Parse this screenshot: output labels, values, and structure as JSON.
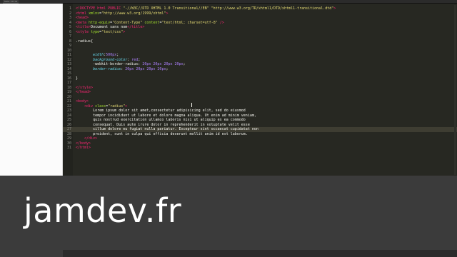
{
  "window": {
    "tab_label": "Sans titre"
  },
  "editor": {
    "lines": [
      {
        "n": "1",
        "parts": [
          [
            "tag",
            "<!DOCTYPE html PUBLIC "
          ],
          [
            "str",
            "\"-//W3C//DTD XHTML 1.0 Transitional//EN\""
          ],
          [
            "txt",
            " "
          ],
          [
            "str",
            "\"http://www.w3.org/TR/xhtml1/DTD/xhtml1-transitional.dtd\""
          ],
          [
            "tag",
            ">"
          ]
        ]
      },
      {
        "n": "2",
        "parts": [
          [
            "tag",
            "<html "
          ],
          [
            "attr",
            "xmlns"
          ],
          [
            "punct",
            "="
          ],
          [
            "str",
            "\"http://www.w3.org/1999/xhtml\""
          ],
          [
            "tag",
            ">"
          ]
        ]
      },
      {
        "n": "3",
        "parts": [
          [
            "tag",
            "<head>"
          ]
        ]
      },
      {
        "n": "4",
        "parts": [
          [
            "tag",
            "<meta "
          ],
          [
            "attr",
            "http-equiv"
          ],
          [
            "punct",
            "="
          ],
          [
            "str",
            "\"Content-Type\""
          ],
          [
            "txt",
            " "
          ],
          [
            "attr",
            "content"
          ],
          [
            "punct",
            "="
          ],
          [
            "str",
            "\"text/html; charset=utf-8\""
          ],
          [
            "txt",
            " "
          ],
          [
            "tag",
            "/>"
          ]
        ]
      },
      {
        "n": "5",
        "parts": [
          [
            "tag",
            "<title>"
          ],
          [
            "txt",
            "Document sans nom"
          ],
          [
            "tag",
            "</title>"
          ]
        ]
      },
      {
        "n": "6",
        "parts": [
          [
            "tag",
            "<style "
          ],
          [
            "attr",
            "type"
          ],
          [
            "punct",
            "="
          ],
          [
            "str",
            "\"text/css\""
          ],
          [
            "tag",
            ">"
          ]
        ]
      },
      {
        "n": "7",
        "parts": []
      },
      {
        "n": "8",
        "parts": [
          [
            "txt",
            ".radius{"
          ]
        ]
      },
      {
        "n": "9",
        "parts": []
      },
      {
        "n": "10",
        "parts": []
      },
      {
        "n": "11",
        "parts": [
          [
            "txt",
            "        "
          ],
          [
            "prop",
            "width"
          ],
          [
            "punct",
            ":"
          ],
          [
            "val",
            "500px"
          ],
          [
            "punct",
            ";"
          ]
        ]
      },
      {
        "n": "12",
        "parts": [
          [
            "txt",
            "        "
          ],
          [
            "prop",
            "background-color"
          ],
          [
            "punct",
            ": "
          ],
          [
            "val",
            "red"
          ],
          [
            "punct",
            ";"
          ]
        ]
      },
      {
        "n": "13",
        "parts": [
          [
            "txt",
            "        "
          ],
          [
            "txt",
            "-webkit-border-radius: "
          ],
          [
            "val",
            "20px 20px 20px 20px"
          ],
          [
            "punct",
            ";"
          ]
        ]
      },
      {
        "n": "14",
        "parts": [
          [
            "txt",
            "        "
          ],
          [
            "prop",
            "border-radius"
          ],
          [
            "punct",
            ": "
          ],
          [
            "val",
            "20px 20px 20px 20px"
          ],
          [
            "punct",
            ";"
          ]
        ]
      },
      {
        "n": "15",
        "parts": []
      },
      {
        "n": "16",
        "parts": [
          [
            "txt",
            "}"
          ]
        ]
      },
      {
        "n": "17",
        "parts": []
      },
      {
        "n": "18",
        "parts": [
          [
            "tag",
            "</style>"
          ]
        ]
      },
      {
        "n": "19",
        "parts": [
          [
            "tag",
            "</head>"
          ]
        ]
      },
      {
        "n": "20",
        "parts": []
      },
      {
        "n": "21",
        "parts": [
          [
            "tag",
            "<body>"
          ]
        ]
      },
      {
        "n": "22",
        "parts": [
          [
            "txt",
            "    "
          ],
          [
            "tag",
            "<div "
          ],
          [
            "attr",
            "class"
          ],
          [
            "punct",
            "="
          ],
          [
            "str",
            "\"radius\""
          ],
          [
            "tag",
            ">"
          ]
        ]
      },
      {
        "n": "23",
        "parts": [
          [
            "txt",
            "        Lorem ipsum dolor sit amet,consectetur adipisicing elit, sed do eiusmod"
          ]
        ]
      },
      {
        "n": "24",
        "parts": [
          [
            "txt",
            "        tempor incididunt ut labore et dolore magna aliqua. Ut enim ad minim veniam,"
          ]
        ]
      },
      {
        "n": "25",
        "parts": [
          [
            "txt",
            "        quis nostrud exercitation ullamco laboris nisi ut aliquip ex ea commodo"
          ]
        ]
      },
      {
        "n": "26",
        "parts": [
          [
            "txt",
            "        consequat. Duis aute irure dolor in reprehenderit in voluptate velit esse"
          ]
        ]
      },
      {
        "n": "27",
        "parts": [
          [
            "txt",
            "        cillum dolore eu fugiat nulla pariatur. Excepteur sint occaecat cupidatat non"
          ]
        ]
      },
      {
        "n": "28",
        "parts": [
          [
            "txt",
            "        proident, sunt in culpa qui officia deserunt mollit anim id est laborum."
          ]
        ]
      },
      {
        "n": "29",
        "parts": [
          [
            "txt",
            "    "
          ],
          [
            "tag",
            "</div>"
          ]
        ]
      },
      {
        "n": "30",
        "parts": [
          [
            "tag",
            "</body>"
          ]
        ]
      },
      {
        "n": "31",
        "parts": [
          [
            "tag",
            "</html>"
          ]
        ]
      }
    ],
    "active_line": "27"
  },
  "watermark": {
    "text": "jamdev.fr"
  }
}
